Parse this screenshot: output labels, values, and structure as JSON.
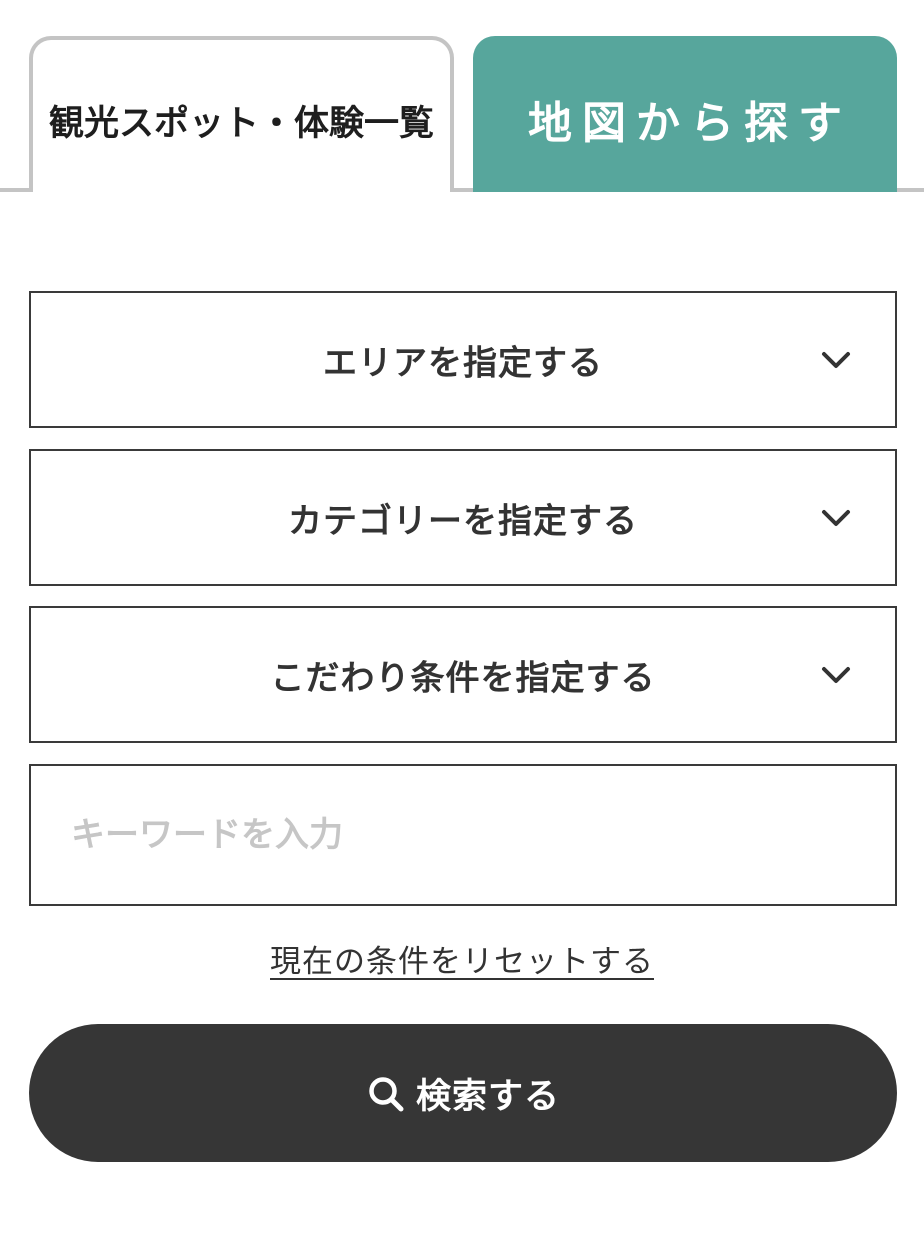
{
  "tabs": {
    "list_label": "観光スポット・体験一覧",
    "map_label": "地図から探す",
    "active": "list",
    "map_color": "#57a69c"
  },
  "filters": {
    "area_label": "エリアを指定する",
    "category_label": "カテゴリーを指定する",
    "feature_label": "こだわり条件を指定する",
    "chevron_icon": "chevron-down-icon"
  },
  "keyword": {
    "value": "",
    "placeholder": "キーワードを入力"
  },
  "reset": {
    "label": "現在の条件をリセットする"
  },
  "search": {
    "label": "検索する",
    "icon": "search-icon",
    "button_color": "#363636"
  }
}
